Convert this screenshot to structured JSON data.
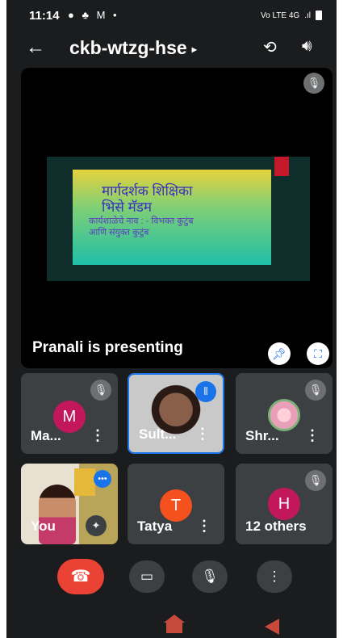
{
  "status_bar": {
    "time": "11:14",
    "notification_icons": "● ♣ M •",
    "network": "Vo LTE 4G",
    "signal": ".ıl"
  },
  "top_bar": {
    "back_icon": "arrow-left-icon",
    "meeting_code": "ckb-wtzg-hse",
    "caret": "▸",
    "switch_camera_icon": "switch-camera-icon",
    "speaker_icon": "speaker-icon"
  },
  "presentation": {
    "presenter_label": "Pranali is presenting",
    "slide": {
      "line1": "मार्गदर्शक शिक्षिका",
      "line2": "भिसे मॅडम",
      "line3": "कार्यशाळेचे नाव : - विभक्त कुटुंब",
      "line4": "आणि संयुक्त कुटुंब"
    },
    "pin_icon": "pin-icon",
    "fullscreen_icon": "fullscreen-icon"
  },
  "participants": [
    {
      "name": "Ma...",
      "initial": "M",
      "avatar_color": "#c2185b",
      "muted": true
    },
    {
      "name": "Sult...",
      "speaking": true
    },
    {
      "name": "Shr...",
      "muted": true
    },
    {
      "name": "You"
    },
    {
      "name": "Tatya",
      "initial": "T",
      "avatar_color": "#f4511e"
    },
    {
      "name": "12 others",
      "initial": "H",
      "avatar_color": "#c2185b",
      "muted": true
    }
  ],
  "controls": {
    "end_call_icon": "end-call-icon",
    "camera_icon": "camera-icon",
    "mic_icon": "mic-icon",
    "more_icon": "more-vert-icon"
  },
  "colors": {
    "background": "#1b1c1e",
    "tile": "#3c4043",
    "accent_blue": "#1a73e8",
    "end_call_red": "#ea4335"
  }
}
